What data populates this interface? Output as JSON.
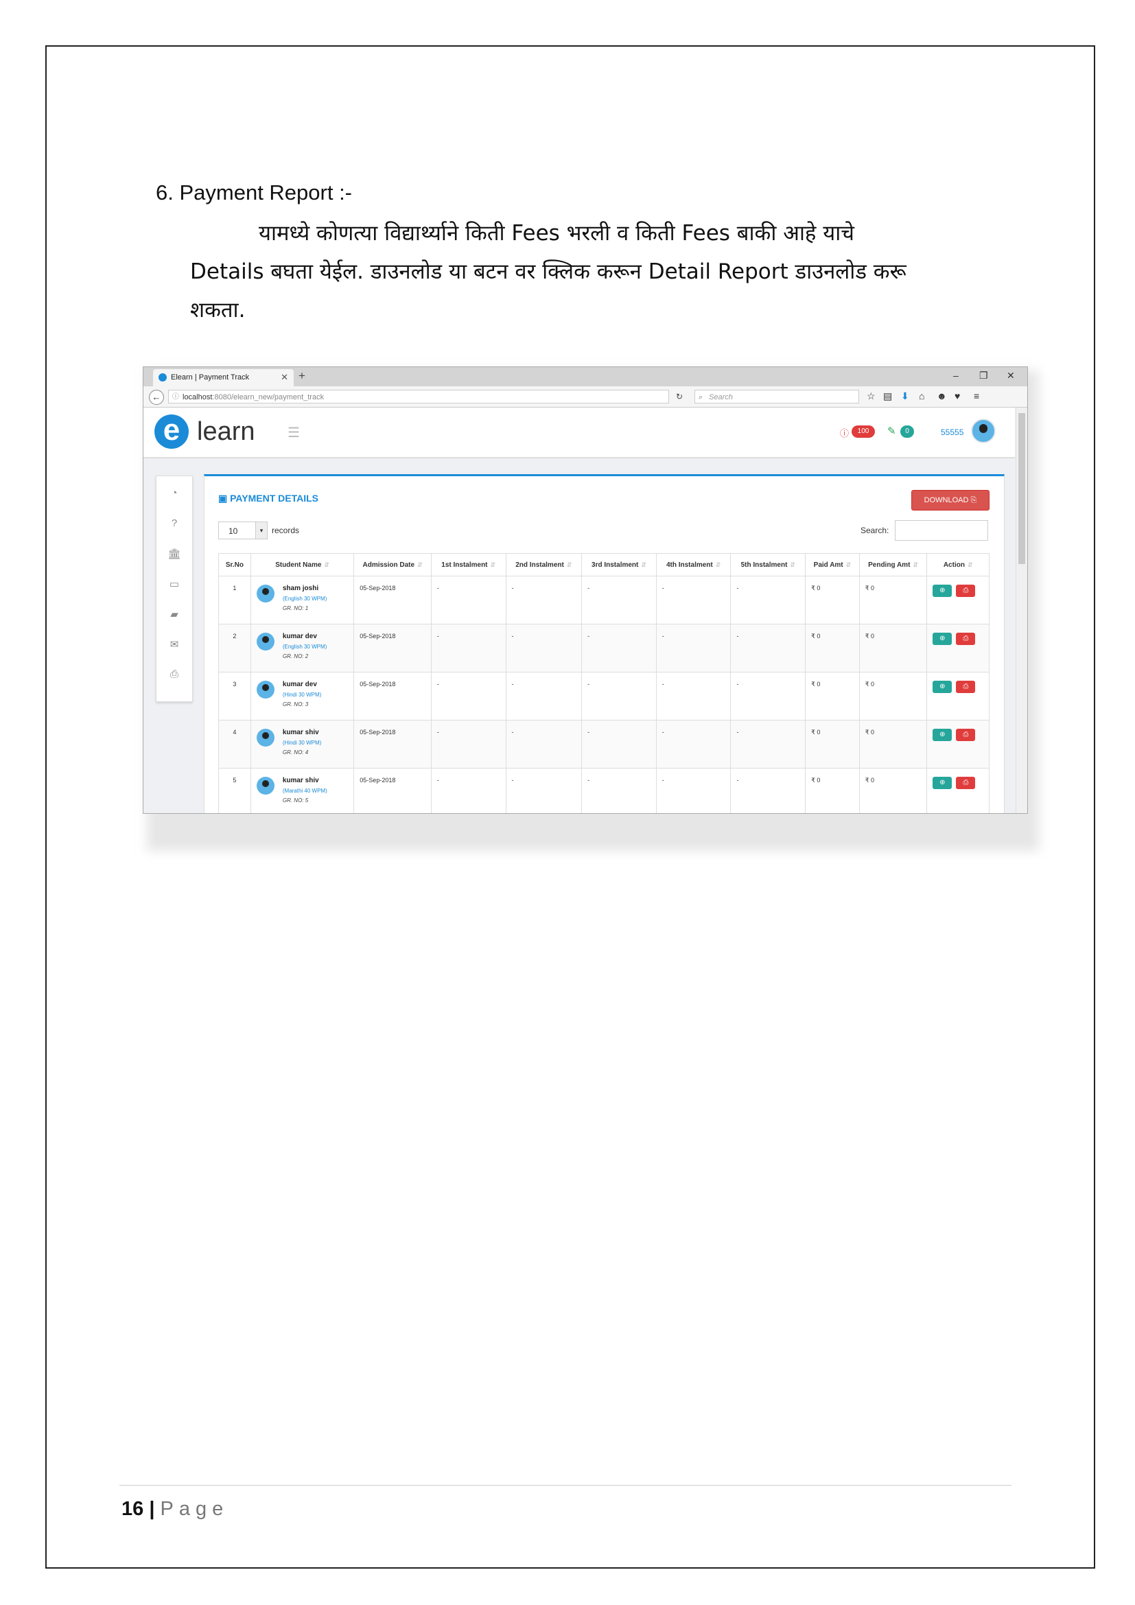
{
  "heading": "6. Payment Report :-",
  "paragraph": {
    "line1": "यामध्ये कोणत्या विद्यार्थ्याने किती Fees भरली व किती Fees बाकी आहे याचे",
    "line2": "Details बघता येईल. डाउनलोड या बटन वर क्लिक करून Detail Report डाउनलोड करू",
    "line3": "शकता."
  },
  "browser": {
    "tab_title": "Elearn | Payment Track",
    "url_host": "localhost",
    "url_path": ":8080/elearn_new/payment_track",
    "search_placeholder": "Search"
  },
  "app": {
    "logo_letter": "e",
    "logo_text": "learn",
    "notif_count": "100",
    "edit_count": "0",
    "user_code": "55555"
  },
  "panel": {
    "title": "PAYMENT DETAILS",
    "download_label": "DOWNLOAD",
    "page_length": "10",
    "records_label": "records",
    "search_label": "Search:"
  },
  "table": {
    "columns": [
      "Sr.No",
      "Student Name",
      "Admission Date",
      "1st Instalment",
      "2nd Instalment",
      "3rd Instalment",
      "4th Instalment",
      "5th Instalment",
      "Paid Amt",
      "Pending Amt",
      "Action"
    ],
    "rows": [
      {
        "sr": "1",
        "name": "sham joshi",
        "course": "(English 30 WPM)",
        "gr": "GR. NO: 1",
        "date": "05-Sep-2018",
        "i1": "-",
        "i2": "-",
        "i3": "-",
        "i4": "-",
        "i5": "-",
        "paid": "₹ 0",
        "pending": "₹ 0"
      },
      {
        "sr": "2",
        "name": "kumar dev",
        "course": "(English 30 WPM)",
        "gr": "GR. NO: 2",
        "date": "05-Sep-2018",
        "i1": "-",
        "i2": "-",
        "i3": "-",
        "i4": "-",
        "i5": "-",
        "paid": "₹ 0",
        "pending": "₹ 0"
      },
      {
        "sr": "3",
        "name": "kumar dev",
        "course": "(Hindi 30 WPM)",
        "gr": "GR. NO: 3",
        "date": "05-Sep-2018",
        "i1": "-",
        "i2": "-",
        "i3": "-",
        "i4": "-",
        "i5": "-",
        "paid": "₹ 0",
        "pending": "₹ 0"
      },
      {
        "sr": "4",
        "name": "kumar shiv",
        "course": "(Hindi 30 WPM)",
        "gr": "GR. NO: 4",
        "date": "05-Sep-2018",
        "i1": "-",
        "i2": "-",
        "i3": "-",
        "i4": "-",
        "i5": "-",
        "paid": "₹ 0",
        "pending": "₹ 0"
      },
      {
        "sr": "5",
        "name": "kumar shiv",
        "course": "(Marathi 40 WPM)",
        "gr": "GR. NO: 5",
        "date": "05-Sep-2018",
        "i1": "-",
        "i2": "-",
        "i3": "-",
        "i4": "-",
        "i5": "-",
        "paid": "₹ 0",
        "pending": "₹ 0"
      }
    ]
  },
  "footer": {
    "page_number": "16",
    "separator": "|",
    "page_word": "Page"
  },
  "colors": {
    "accent": "#1b8bd8",
    "danger": "#d9534f",
    "success": "#26a69a"
  }
}
